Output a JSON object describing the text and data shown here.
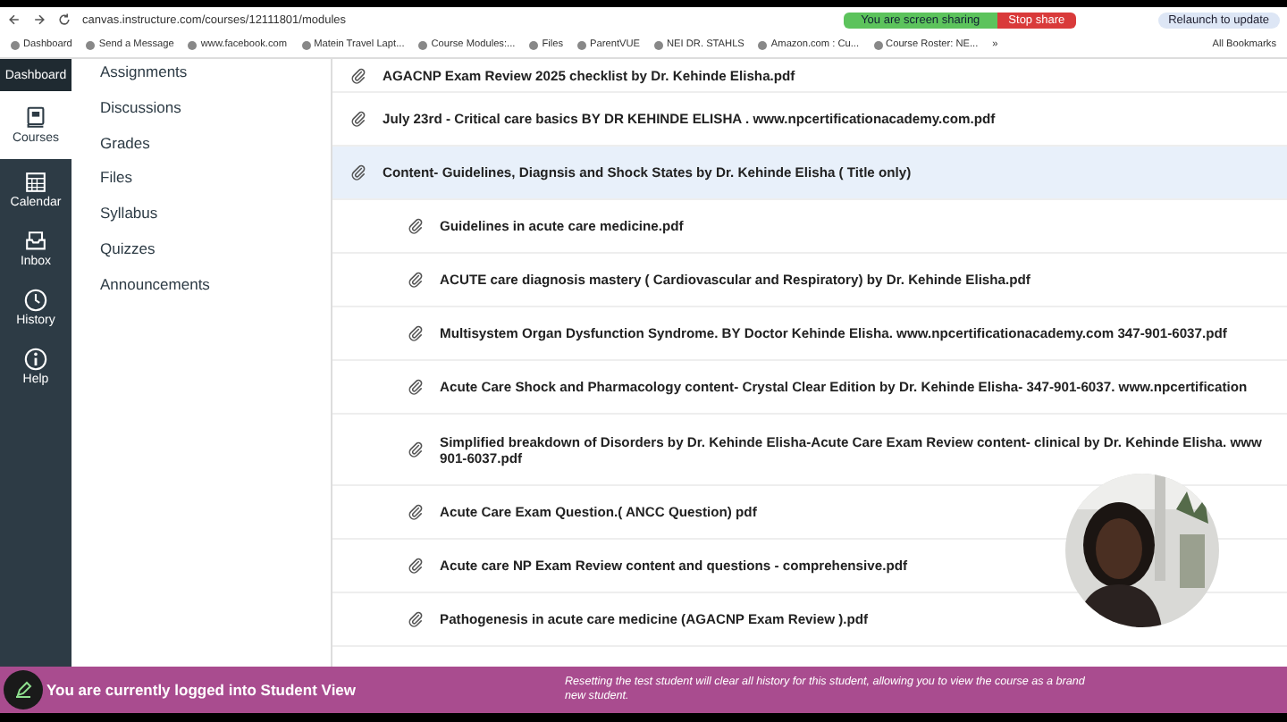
{
  "browser": {
    "url": "canvas.instructure.com/courses/12111801/modules",
    "sharing": "You are screen sharing",
    "stop_share": "Stop share",
    "relaunch": "Relaunch to update",
    "bookmarks": [
      "Dashboard",
      "Send a Message",
      "www.facebook.com",
      "Matein Travel Lapt...",
      "Course Modules:...",
      "Files",
      "ParentVUE",
      "NEI DR. STAHLS",
      "Amazon.com : Cu...",
      "Course Roster: NE...",
      "»"
    ],
    "all_bookmarks": "All Bookmarks"
  },
  "global_nav": [
    {
      "label": "Dashboard",
      "selected": false
    },
    {
      "label": "Courses",
      "selected": true
    },
    {
      "label": "Calendar",
      "selected": false
    },
    {
      "label": "Inbox",
      "selected": false
    },
    {
      "label": "History",
      "selected": false
    },
    {
      "label": "Help",
      "selected": false
    }
  ],
  "course_nav": [
    "Assignments",
    "Discussions",
    "Grades",
    "Files",
    "Syllabus",
    "Quizzes",
    "Announcements"
  ],
  "modules": [
    {
      "lines": [
        "AGACNP Exam Review 2025 checklist by Dr. Kehinde Elisha.pdf"
      ],
      "selected": false
    },
    {
      "lines": [
        "July 23rd - Critical care basics BY DR KEHINDE ELISHA . www.npcertificationacademy.com.pdf"
      ],
      "selected": false
    },
    {
      "lines": [
        "Content- Guidelines, Diagnsis and Shock States by Dr. Kehinde Elisha ( Title only)"
      ],
      "selected": true,
      "children": [
        {
          "lines": [
            "Guidelines in acute care medicine.pdf"
          ]
        },
        {
          "lines": [
            "ACUTE care diagnosis mastery ( Cardiovascular and Respiratory) by Dr. Kehinde Elisha.pdf"
          ]
        },
        {
          "lines": [
            "Multisystem Organ Dysfunction Syndrome. BY Doctor Kehinde Elisha. www.npcertificationacademy.com 347-901-6037.pdf"
          ]
        },
        {
          "lines": [
            "Acute Care Shock and Pharmacology content- Crystal Clear Edition by Dr. Kehinde Elisha- 347-901-6037. www.npcertification"
          ]
        },
        {
          "lines": [
            "Simplified breakdown of Disorders by Dr. Kehinde Elisha-Acute Care Exam Review content- clinical by Dr. Kehinde Elisha. www",
            "901-6037.pdf"
          ]
        },
        {
          "lines": [
            "Acute Care Exam Question.( ANCC Question) pdf"
          ]
        },
        {
          "lines": [
            "Acute care NP Exam Review content and questions - comprehensive.pdf"
          ]
        },
        {
          "lines": [
            "Pathogenesis in acute care medicine (AGACNP Exam Review ).pdf"
          ]
        }
      ]
    }
  ],
  "webcam": {
    "kind": "picture"
  },
  "student_view": {
    "message": "You are currently logged into Student View",
    "note": "Resetting the test student will clear all history for this student, allowing you to view the course as a brand new student."
  }
}
